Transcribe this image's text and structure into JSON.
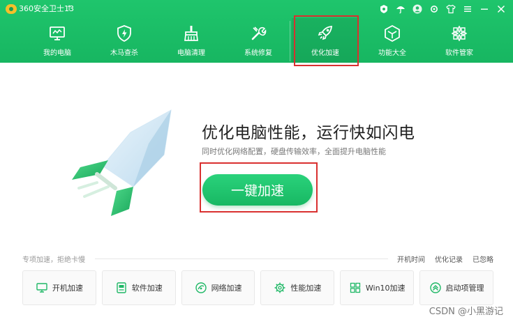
{
  "app": {
    "title": "360安全卫士13",
    "update_glyph": "↑"
  },
  "titlebar_icons": [
    "shield-badge-icon",
    "umbrella-icon",
    "avatar",
    "settings-icon",
    "shirt-icon",
    "menu-icon",
    "minimize-icon",
    "close-icon"
  ],
  "nav": {
    "items": [
      {
        "label": "我的电脑",
        "icon": "monitor-icon"
      },
      {
        "label": "木马查杀",
        "icon": "shield-bolt-icon"
      },
      {
        "label": "电脑清理",
        "icon": "broom-icon"
      },
      {
        "label": "系统修复",
        "icon": "wrench-icon"
      },
      {
        "label": "优化加速",
        "icon": "rocket-icon",
        "active": true
      },
      {
        "label": "功能大全",
        "icon": "cube-icon"
      },
      {
        "label": "软件管家",
        "icon": "apps-icon"
      }
    ]
  },
  "hero": {
    "title": "优化电脑性能，运行快如闪电",
    "subtitle": "同时优化网络配置，硬盘传输效率，全面提升电脑性能",
    "button_label": "一键加速"
  },
  "special": {
    "label": "专项加速，拒绝卡慢",
    "links": [
      "开机时间",
      "优化记录",
      "已忽略"
    ],
    "tiles": [
      {
        "label": "开机加速",
        "icon": "monitor-icon"
      },
      {
        "label": "软件加速",
        "icon": "software-icon"
      },
      {
        "label": "网络加速",
        "icon": "network-icon"
      },
      {
        "label": "性能加速",
        "icon": "gear-icon"
      },
      {
        "label": "Win10加速",
        "icon": "windows-icon"
      },
      {
        "label": "启动项管理",
        "icon": "startup-icon"
      }
    ]
  },
  "watermark": "CSDN @小黑游记",
  "colors": {
    "brand": "#1fc56c",
    "annotation": "#d9302f"
  }
}
